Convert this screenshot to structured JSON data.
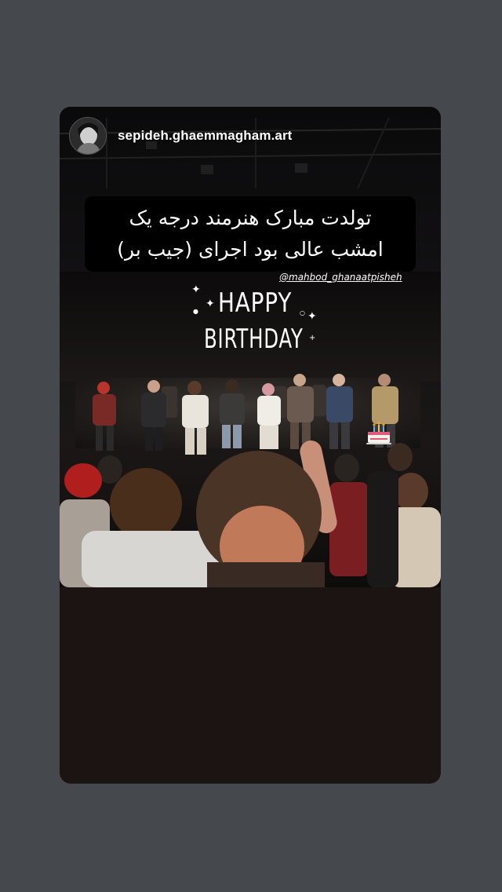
{
  "story": {
    "username": "sepideh.ghaemmagham.art",
    "avatar_icon": "profile-avatar-icon",
    "caption_lines": [
      "تولدت مبارک هنرمند درجه یک",
      "امشب عالی بود اجرای (جیب بر)"
    ],
    "mention": "@mahbod_ghanaatpisheh",
    "sticker": {
      "line1": "HAPPY",
      "line2": "BIRTHDAY",
      "icon": "cake-icon"
    }
  },
  "colors": {
    "background": "#45484c",
    "card": "#1c1412",
    "caption_bg": "#000000",
    "text": "#ffffff"
  }
}
